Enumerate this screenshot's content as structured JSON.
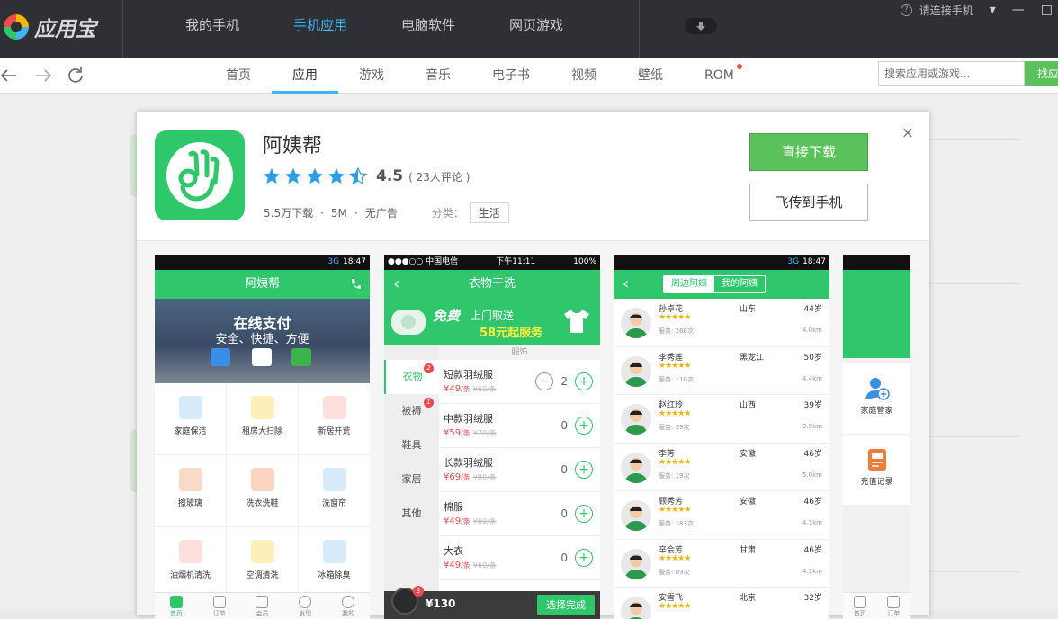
{
  "window": {
    "app_name": "应用宝",
    "connect_text": "请连接手机",
    "help_icon": "?"
  },
  "main_nav": [
    "我的手机",
    "手机应用",
    "电脑软件",
    "网页游戏"
  ],
  "sub_nav": [
    "首页",
    "应用",
    "游戏",
    "音乐",
    "电子书",
    "视频",
    "壁纸",
    "ROM"
  ],
  "search": {
    "placeholder": "搜索应用或游戏...",
    "button": "找应"
  },
  "app": {
    "name": "阿姨帮",
    "rating": "4.5",
    "rating_value": 4.5,
    "reviews": "( 23人评论 )",
    "downloads": "5.5万下载",
    "size": "5M",
    "ads": "无广告",
    "dot": "·",
    "category_label": "分类：",
    "category": "生活",
    "download_button": "直接下载",
    "send_button": "飞传到手机",
    "close_icon": "×"
  },
  "shot1": {
    "status_net": "3G",
    "time": "18:47",
    "title": "阿姨帮",
    "banner_title": "在线支付",
    "banner_sub": "安全、快捷、方便",
    "services": [
      "家庭保洁",
      "租房大扫除",
      "新居开荒",
      "擦玻璃",
      "洗衣洗鞋",
      "洗窗帘",
      "油烟机清洗",
      "空调清洗",
      "冰箱除臭"
    ],
    "tabs": [
      "首页",
      "订单",
      "会员",
      "发现",
      "我的"
    ]
  },
  "shot2": {
    "carrier": "●●●○○ 中国电信",
    "time": "下午11:11",
    "battery": "100%",
    "title": "衣物干洗",
    "banner_a": "免费",
    "banner_b": "上门取送",
    "banner_c": "58元起服务",
    "categories": [
      {
        "name": "衣物",
        "badge": "2"
      },
      {
        "name": "被褥",
        "badge": "1"
      },
      {
        "name": "鞋具",
        "badge": ""
      },
      {
        "name": "家居",
        "badge": ""
      },
      {
        "name": "其他",
        "badge": ""
      }
    ],
    "section": "服饰",
    "items": [
      {
        "name": "短款羽绒服",
        "price": "¥49",
        "unit": "/条",
        "old": "¥60/条",
        "qty": "2"
      },
      {
        "name": "中款羽绒服",
        "price": "¥59",
        "unit": "/条",
        "old": "¥70/条",
        "qty": "0"
      },
      {
        "name": "长款羽绒服",
        "price": "¥69",
        "unit": "/条",
        "old": "¥80/条",
        "qty": "0"
      },
      {
        "name": "棉服",
        "price": "¥49",
        "unit": "/条",
        "old": "¥60/条",
        "qty": "0"
      },
      {
        "name": "大衣",
        "price": "¥49",
        "unit": "/条",
        "old": "¥60/条",
        "qty": "0"
      }
    ],
    "cart_count": "3",
    "cart_total": "¥130",
    "checkout": "选择完成"
  },
  "shot3": {
    "status_net": "3G",
    "time": "18:47",
    "seg_a": "周边阿姨",
    "seg_b": "我的阿姨",
    "stars": "★★★★★",
    "aunts": [
      {
        "name": "孙卓花",
        "prov": "山东",
        "age": "44岁",
        "served": "服务: 268次",
        "dist": "4.0km"
      },
      {
        "name": "李秀莲",
        "prov": "黑龙江",
        "age": "50岁",
        "served": "服务: 110次",
        "dist": "4.4km"
      },
      {
        "name": "赵红玲",
        "prov": "山西",
        "age": "39岁",
        "served": "服务: 39次",
        "dist": "3.9km"
      },
      {
        "name": "李芳",
        "prov": "安徽",
        "age": "46岁",
        "served": "服务: 19次",
        "dist": "5.0km"
      },
      {
        "name": "顾秀芳",
        "prov": "安徽",
        "age": "46岁",
        "served": "服务: 183次",
        "dist": "4.1km"
      },
      {
        "name": "辛会芳",
        "prov": "甘肃",
        "age": "46岁",
        "served": "服务: 89次",
        "dist": "4.1km"
      },
      {
        "name": "安雪飞",
        "prov": "北京",
        "age": "32岁",
        "served": "",
        "dist": ""
      }
    ]
  },
  "shot4": {
    "items": [
      "家庭管家",
      "充值记录"
    ],
    "tabs": [
      "首页",
      "订单"
    ]
  },
  "colors": {
    "green": "#2fc66c",
    "button_green": "#5bc15b",
    "accent_blue": "#3eb4f0",
    "topbar": "#2e3035",
    "star_blue": "#2a9ee8"
  }
}
